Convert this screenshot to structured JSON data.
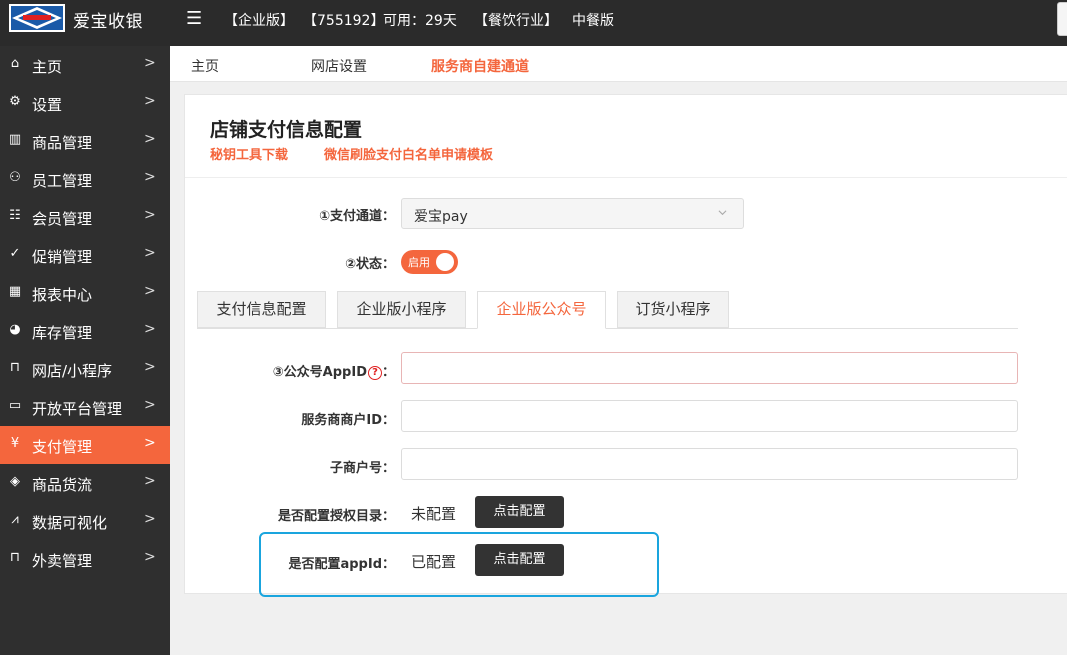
{
  "header": {
    "brand": "爱宝收银",
    "edition": "【企业版】",
    "shop_id": "【755192】",
    "available_days": "可用：29天",
    "industry": "【餐饮行业】",
    "cuisine": "中餐版"
  },
  "sidebar": {
    "items": [
      {
        "label": "主页",
        "icon": "home-icon"
      },
      {
        "label": "设置",
        "icon": "gear-icon"
      },
      {
        "label": "商品管理",
        "icon": "barcode-icon"
      },
      {
        "label": "员工管理",
        "icon": "user-icon"
      },
      {
        "label": "会员管理",
        "icon": "member-card-icon"
      },
      {
        "label": "促销管理",
        "icon": "check-circle-icon"
      },
      {
        "label": "报表中心",
        "icon": "bar-chart-icon"
      },
      {
        "label": "库存管理",
        "icon": "pie-chart-icon"
      },
      {
        "label": "网店/小程序",
        "icon": "store-icon"
      },
      {
        "label": "开放平台管理",
        "icon": "monitor-icon"
      },
      {
        "label": "支付管理",
        "icon": "yuan-coin-icon",
        "active": true
      },
      {
        "label": "商品货流",
        "icon": "box-icon"
      },
      {
        "label": "数据可视化",
        "icon": "line-chart-icon"
      },
      {
        "label": "外卖管理",
        "icon": "shop-icon"
      }
    ]
  },
  "tabs": [
    {
      "label": "主页"
    },
    {
      "label": "网店设置"
    },
    {
      "label": "服务商自建通道",
      "active": true
    }
  ],
  "card": {
    "title": "店铺支付信息配置",
    "link_key_tool": "秘钥工具下载",
    "link_whitelist": "微信刷脸支付白名单申请模板"
  },
  "form": {
    "channel_label": "①支付通道：",
    "channel_value": "爱宝pay",
    "status_label": "②状态：",
    "status_switch": "启用",
    "pay_tabs": [
      {
        "label": "支付信息配置"
      },
      {
        "label": "企业版小程序"
      },
      {
        "label": "企业版公众号",
        "active": true
      },
      {
        "label": "订货小程序"
      }
    ],
    "appid_label": "③公众号AppID",
    "appid_help": "?",
    "colon": "：",
    "appid_value": "",
    "merchant_id_label": "服务商商户ID：",
    "merchant_id_value": "",
    "sub_merchant_label": "子商户号：",
    "sub_merchant_value": "",
    "auth_dir_label": "是否配置授权目录：",
    "auth_dir_status": "未配置",
    "auth_dir_button": "点击配置",
    "appid_config_label": "是否配置appId：",
    "appid_config_status": "已配置",
    "appid_config_button": "点击配置"
  },
  "colors": {
    "accent": "#f4663d",
    "sidebar_bg": "#2f2f2f",
    "topbar_bg": "#2b2b2b",
    "highlight_border": "#1aa5de"
  }
}
